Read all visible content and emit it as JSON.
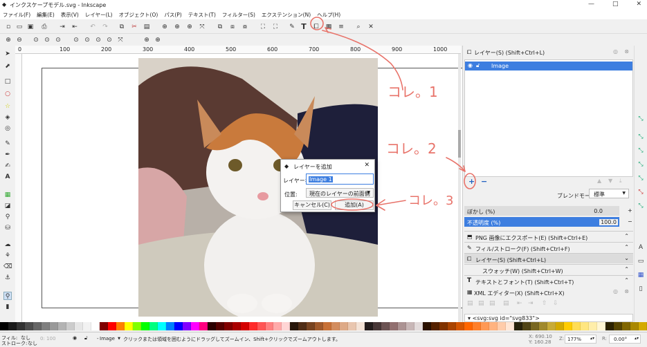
{
  "window": {
    "title": "インクスケープモデル.svg - Inkscape",
    "minimize": "—",
    "maximize": "□",
    "close": "✕"
  },
  "menu": [
    "ファイル(F)",
    "編集(E)",
    "表示(V)",
    "レイヤー(L)",
    "オブジェクト(O)",
    "パス(P)",
    "テキスト(T)",
    "フィルター(S)",
    "エクステンション(N)",
    "ヘルプ(H)"
  ],
  "layers_panel": {
    "title": "レイヤー(S) (Shift+Ctrl+L)",
    "layer_name": "Image",
    "add_button": "+",
    "remove_button": "−",
    "blend_label": "ブレンドモード:",
    "blend_value": "標準",
    "blur_label": "ぼかし (%)",
    "blur_value": "0.0",
    "opacity_label": "不透明度 (%)",
    "opacity_value": "100.0"
  },
  "docked_dialogs": [
    "PNG 画像にエクスポート(E) (Shift+Ctrl+E)",
    "フィル/ストローク(F) (Shift+Ctrl+F)",
    "レイヤー(S) (Shift+Ctrl+L)",
    "スウォッチ(W) (Shift+Ctrl+W)",
    "テキストとフォント(T) (Shift+Ctrl+T)",
    "XML エディター(X) (Shift+Ctrl+X)"
  ],
  "xml_node": "<svg:svg id=\"svg833\">",
  "dialog": {
    "title": "レイヤーを追加",
    "name_label": "レイヤー名:",
    "name_value": "Image 1",
    "position_label": "位置:",
    "position_value": "現在のレイヤーの前面側",
    "cancel": "キャンセル(C)",
    "add": "追加(A)",
    "close": "✕"
  },
  "annotations": {
    "a1": "コレ。1",
    "a2": "コレ。2",
    "a3": "コレ。3"
  },
  "status": {
    "fill_label": "フィル:",
    "fill_value": "なし",
    "stroke_label": "ストローク:",
    "stroke_value": "なし",
    "opacity": "0: 100",
    "layer": "Image",
    "message": "クリックまたは領域を囲むようにドラッグしてズームイン、Shift+クリックでズームアウトします。",
    "x": "X: 690.10",
    "y": "Y: 160.28",
    "zoom_label": "Z:",
    "zoom": "177%",
    "rot_label": "R:",
    "rotation": "0.00°"
  },
  "colors": {
    "selection": "#3d7ee0",
    "annotation": "#e8736a"
  },
  "rulers": [
    "0",
    "100",
    "200",
    "300",
    "400",
    "500",
    "600",
    "700",
    "800",
    "900",
    "1000"
  ]
}
